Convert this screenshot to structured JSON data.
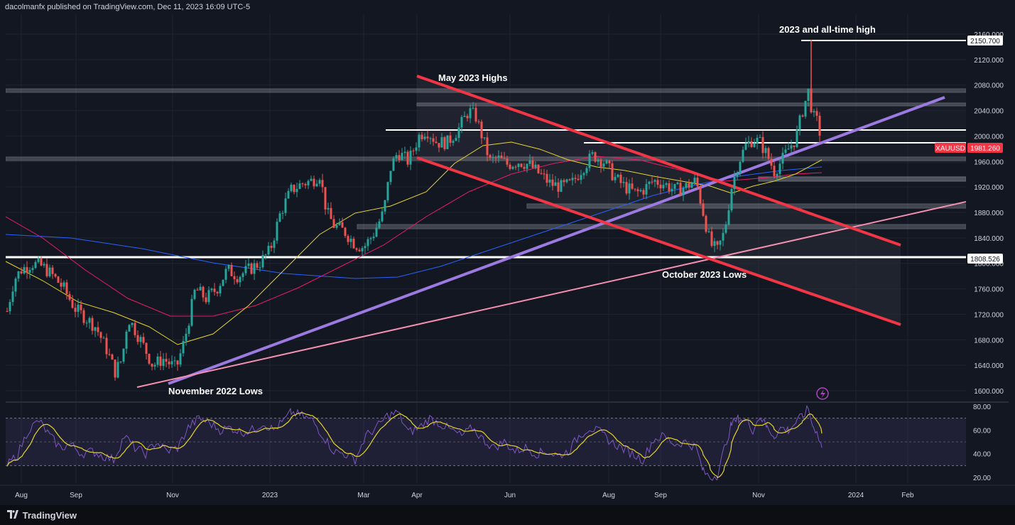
{
  "header": {
    "published": "dacolmanfx published on TradingView.com, Dec 11, 2023 16:09 UTC-5"
  },
  "footer": {
    "brand": "TradingView"
  },
  "chart_data": [
    {
      "type": "candlestick",
      "symbol": "XAUUSD",
      "last_price": "1981.260",
      "ath_label": "2150.700",
      "support_label": "1808.526",
      "ylim": [
        1590,
        2170
      ],
      "y_ticks": [
        "2160.000",
        "2120.000",
        "2080.000",
        "2040.000",
        "2000.000",
        "1960.000",
        "1920.000",
        "1880.000",
        "1840.000",
        "1800.000",
        "1760.000",
        "1720.000",
        "1680.000",
        "1640.000",
        "1600.000"
      ],
      "y_tick_values": [
        2160,
        2120,
        2080,
        2040,
        2000,
        1960,
        1920,
        1880,
        1840,
        1800,
        1760,
        1720,
        1680,
        1640,
        1600
      ],
      "x_ticks": [
        "Aug",
        "Sep",
        "Nov",
        "2023",
        "Mar",
        "Apr",
        "Jun",
        "Aug",
        "Sep",
        "Nov",
        "2024",
        "Feb"
      ],
      "x_tick_pos": [
        30,
        107,
        243,
        380,
        512,
        587,
        718,
        857,
        930,
        1068,
        1205,
        1278
      ],
      "annotations": {
        "ath": "2023 and all-time high",
        "may_highs": "May 2023 Highs",
        "oct_lows": "October 2023 Lows",
        "nov_lows": "November 2022 Lows"
      },
      "price_path": [
        [
          10,
          1725
        ],
        [
          20,
          1775
        ],
        [
          30,
          1790
        ],
        [
          45,
          1800
        ],
        [
          60,
          1795
        ],
        [
          75,
          1780
        ],
        [
          90,
          1760
        ],
        [
          105,
          1730
        ],
        [
          120,
          1715
        ],
        [
          135,
          1700
        ],
        [
          150,
          1665
        ],
        [
          162,
          1630
        ],
        [
          172,
          1650
        ],
        [
          180,
          1715
        ],
        [
          188,
          1700
        ],
        [
          200,
          1675
        ],
        [
          215,
          1640
        ],
        [
          230,
          1650
        ],
        [
          248,
          1635
        ],
        [
          260,
          1680
        ],
        [
          275,
          1760
        ],
        [
          290,
          1745
        ],
        [
          305,
          1760
        ],
        [
          320,
          1790
        ],
        [
          335,
          1780
        ],
        [
          350,
          1790
        ],
        [
          365,
          1800
        ],
        [
          380,
          1820
        ],
        [
          395,
          1880
        ],
        [
          410,
          1915
        ],
        [
          425,
          1925
        ],
        [
          440,
          1930
        ],
        [
          450,
          1940
        ],
        [
          460,
          1880
        ],
        [
          470,
          1860
        ],
        [
          485,
          1850
        ],
        [
          500,
          1830
        ],
        [
          512,
          1825
        ],
        [
          525,
          1845
        ],
        [
          540,
          1880
        ],
        [
          550,
          1950
        ],
        [
          560,
          1975
        ],
        [
          575,
          1960
        ],
        [
          590,
          2000
        ],
        [
          600,
          2010
        ],
        [
          615,
          1990
        ],
        [
          630,
          1990
        ],
        [
          645,
          2010
        ],
        [
          660,
          2040
        ],
        [
          670,
          2030
        ],
        [
          680,
          1995
        ],
        [
          690,
          1960
        ],
        [
          700,
          1965
        ],
        [
          715,
          1955
        ],
        [
          730,
          1960
        ],
        [
          745,
          1955
        ],
        [
          760,
          1940
        ],
        [
          775,
          1925
        ],
        [
          790,
          1920
        ],
        [
          805,
          1925
        ],
        [
          820,
          1950
        ],
        [
          835,
          1970
        ],
        [
          850,
          1960
        ],
        [
          865,
          1935
        ],
        [
          880,
          1920
        ],
        [
          895,
          1910
        ],
        [
          905,
          1915
        ],
        [
          920,
          1930
        ],
        [
          935,
          1925
        ],
        [
          950,
          1915
        ],
        [
          965,
          1920
        ],
        [
          980,
          1930
        ],
        [
          990,
          1880
        ],
        [
          1000,
          1830
        ],
        [
          1010,
          1820
        ],
        [
          1020,
          1850
        ],
        [
          1030,
          1920
        ],
        [
          1040,
          1960
        ],
        [
          1050,
          1985
        ],
        [
          1060,
          1995
        ],
        [
          1070,
          1990
        ],
        [
          1080,
          1970
        ],
        [
          1090,
          1945
        ],
        [
          1100,
          1960
        ],
        [
          1110,
          1980
        ],
        [
          1120,
          1995
        ],
        [
          1130,
          2040
        ],
        [
          1138,
          2070
        ],
        [
          1145,
          2030
        ],
        [
          1152,
          2020
        ],
        [
          1157,
          1985
        ]
      ],
      "rsi": {
        "ylim": [
          15,
          85
        ],
        "y_ticks": [
          "80.00",
          "60.00",
          "40.00",
          "20.00"
        ],
        "y_tick_values": [
          80,
          60,
          40,
          20
        ],
        "band": [
          30,
          70
        ],
        "path": [
          [
            10,
            30
          ],
          [
            25,
            40
          ],
          [
            40,
            60
          ],
          [
            55,
            68
          ],
          [
            70,
            55
          ],
          [
            85,
            45
          ],
          [
            100,
            48
          ],
          [
            115,
            40
          ],
          [
            130,
            42
          ],
          [
            145,
            38
          ],
          [
            160,
            35
          ],
          [
            175,
            55
          ],
          [
            190,
            45
          ],
          [
            205,
            40
          ],
          [
            220,
            50
          ],
          [
            235,
            42
          ],
          [
            250,
            45
          ],
          [
            265,
            62
          ],
          [
            280,
            70
          ],
          [
            295,
            66
          ],
          [
            310,
            60
          ],
          [
            325,
            62
          ],
          [
            340,
            58
          ],
          [
            355,
            60
          ],
          [
            370,
            66
          ],
          [
            385,
            60
          ],
          [
            400,
            68
          ],
          [
            410,
            75
          ],
          [
            425,
            72
          ],
          [
            440,
            68
          ],
          [
            455,
            55
          ],
          [
            470,
            42
          ],
          [
            485,
            40
          ],
          [
            500,
            35
          ],
          [
            515,
            55
          ],
          [
            530,
            62
          ],
          [
            545,
            72
          ],
          [
            560,
            75
          ],
          [
            575,
            58
          ],
          [
            590,
            62
          ],
          [
            605,
            70
          ],
          [
            620,
            65
          ],
          [
            635,
            60
          ],
          [
            650,
            55
          ],
          [
            665,
            62
          ],
          [
            680,
            52
          ],
          [
            695,
            45
          ],
          [
            710,
            50
          ],
          [
            725,
            42
          ],
          [
            740,
            45
          ],
          [
            755,
            40
          ],
          [
            770,
            42
          ],
          [
            785,
            38
          ],
          [
            800,
            42
          ],
          [
            815,
            55
          ],
          [
            830,
            62
          ],
          [
            845,
            58
          ],
          [
            860,
            50
          ],
          [
            875,
            45
          ],
          [
            890,
            40
          ],
          [
            905,
            35
          ],
          [
            920,
            52
          ],
          [
            935,
            55
          ],
          [
            950,
            48
          ],
          [
            965,
            50
          ],
          [
            980,
            45
          ],
          [
            990,
            25
          ],
          [
            1000,
            20
          ],
          [
            1010,
            22
          ],
          [
            1020,
            45
          ],
          [
            1030,
            65
          ],
          [
            1040,
            70
          ],
          [
            1050,
            68
          ],
          [
            1060,
            60
          ],
          [
            1070,
            72
          ],
          [
            1080,
            62
          ],
          [
            1090,
            55
          ],
          [
            1100,
            62
          ],
          [
            1110,
            60
          ],
          [
            1120,
            66
          ],
          [
            1130,
            72
          ],
          [
            1138,
            78
          ],
          [
            1145,
            62
          ],
          [
            1150,
            60
          ],
          [
            1157,
            45
          ]
        ]
      }
    }
  ]
}
